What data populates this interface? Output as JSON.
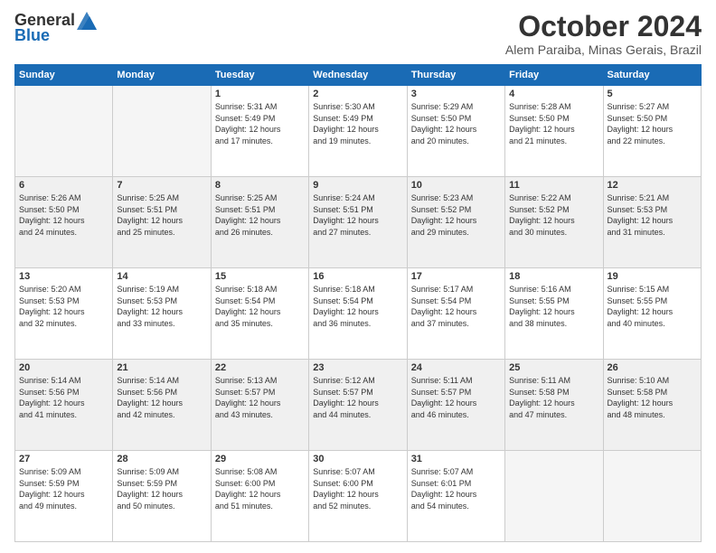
{
  "header": {
    "logo_general": "General",
    "logo_blue": "Blue",
    "month_title": "October 2024",
    "location": "Alem Paraiba, Minas Gerais, Brazil"
  },
  "days_of_week": [
    "Sunday",
    "Monday",
    "Tuesday",
    "Wednesday",
    "Thursday",
    "Friday",
    "Saturday"
  ],
  "weeks": [
    [
      {
        "day": "",
        "empty": true
      },
      {
        "day": "",
        "empty": true
      },
      {
        "day": "1",
        "sunrise": "5:31 AM",
        "sunset": "5:49 PM",
        "daylight": "12 hours and 17 minutes."
      },
      {
        "day": "2",
        "sunrise": "5:30 AM",
        "sunset": "5:49 PM",
        "daylight": "12 hours and 19 minutes."
      },
      {
        "day": "3",
        "sunrise": "5:29 AM",
        "sunset": "5:50 PM",
        "daylight": "12 hours and 20 minutes."
      },
      {
        "day": "4",
        "sunrise": "5:28 AM",
        "sunset": "5:50 PM",
        "daylight": "12 hours and 21 minutes."
      },
      {
        "day": "5",
        "sunrise": "5:27 AM",
        "sunset": "5:50 PM",
        "daylight": "12 hours and 22 minutes."
      }
    ],
    [
      {
        "day": "6",
        "sunrise": "5:26 AM",
        "sunset": "5:50 PM",
        "daylight": "12 hours and 24 minutes."
      },
      {
        "day": "7",
        "sunrise": "5:25 AM",
        "sunset": "5:51 PM",
        "daylight": "12 hours and 25 minutes."
      },
      {
        "day": "8",
        "sunrise": "5:25 AM",
        "sunset": "5:51 PM",
        "daylight": "12 hours and 26 minutes."
      },
      {
        "day": "9",
        "sunrise": "5:24 AM",
        "sunset": "5:51 PM",
        "daylight": "12 hours and 27 minutes."
      },
      {
        "day": "10",
        "sunrise": "5:23 AM",
        "sunset": "5:52 PM",
        "daylight": "12 hours and 29 minutes."
      },
      {
        "day": "11",
        "sunrise": "5:22 AM",
        "sunset": "5:52 PM",
        "daylight": "12 hours and 30 minutes."
      },
      {
        "day": "12",
        "sunrise": "5:21 AM",
        "sunset": "5:53 PM",
        "daylight": "12 hours and 31 minutes."
      }
    ],
    [
      {
        "day": "13",
        "sunrise": "5:20 AM",
        "sunset": "5:53 PM",
        "daylight": "12 hours and 32 minutes."
      },
      {
        "day": "14",
        "sunrise": "5:19 AM",
        "sunset": "5:53 PM",
        "daylight": "12 hours and 33 minutes."
      },
      {
        "day": "15",
        "sunrise": "5:18 AM",
        "sunset": "5:54 PM",
        "daylight": "12 hours and 35 minutes."
      },
      {
        "day": "16",
        "sunrise": "5:18 AM",
        "sunset": "5:54 PM",
        "daylight": "12 hours and 36 minutes."
      },
      {
        "day": "17",
        "sunrise": "5:17 AM",
        "sunset": "5:54 PM",
        "daylight": "12 hours and 37 minutes."
      },
      {
        "day": "18",
        "sunrise": "5:16 AM",
        "sunset": "5:55 PM",
        "daylight": "12 hours and 38 minutes."
      },
      {
        "day": "19",
        "sunrise": "5:15 AM",
        "sunset": "5:55 PM",
        "daylight": "12 hours and 40 minutes."
      }
    ],
    [
      {
        "day": "20",
        "sunrise": "5:14 AM",
        "sunset": "5:56 PM",
        "daylight": "12 hours and 41 minutes."
      },
      {
        "day": "21",
        "sunrise": "5:14 AM",
        "sunset": "5:56 PM",
        "daylight": "12 hours and 42 minutes."
      },
      {
        "day": "22",
        "sunrise": "5:13 AM",
        "sunset": "5:57 PM",
        "daylight": "12 hours and 43 minutes."
      },
      {
        "day": "23",
        "sunrise": "5:12 AM",
        "sunset": "5:57 PM",
        "daylight": "12 hours and 44 minutes."
      },
      {
        "day": "24",
        "sunrise": "5:11 AM",
        "sunset": "5:57 PM",
        "daylight": "12 hours and 46 minutes."
      },
      {
        "day": "25",
        "sunrise": "5:11 AM",
        "sunset": "5:58 PM",
        "daylight": "12 hours and 47 minutes."
      },
      {
        "day": "26",
        "sunrise": "5:10 AM",
        "sunset": "5:58 PM",
        "daylight": "12 hours and 48 minutes."
      }
    ],
    [
      {
        "day": "27",
        "sunrise": "5:09 AM",
        "sunset": "5:59 PM",
        "daylight": "12 hours and 49 minutes."
      },
      {
        "day": "28",
        "sunrise": "5:09 AM",
        "sunset": "5:59 PM",
        "daylight": "12 hours and 50 minutes."
      },
      {
        "day": "29",
        "sunrise": "5:08 AM",
        "sunset": "6:00 PM",
        "daylight": "12 hours and 51 minutes."
      },
      {
        "day": "30",
        "sunrise": "5:07 AM",
        "sunset": "6:00 PM",
        "daylight": "12 hours and 52 minutes."
      },
      {
        "day": "31",
        "sunrise": "5:07 AM",
        "sunset": "6:01 PM",
        "daylight": "12 hours and 54 minutes."
      },
      {
        "day": "",
        "empty": true
      },
      {
        "day": "",
        "empty": true
      }
    ]
  ],
  "labels": {
    "sunrise": "Sunrise:",
    "sunset": "Sunset:",
    "daylight": "Daylight:"
  }
}
